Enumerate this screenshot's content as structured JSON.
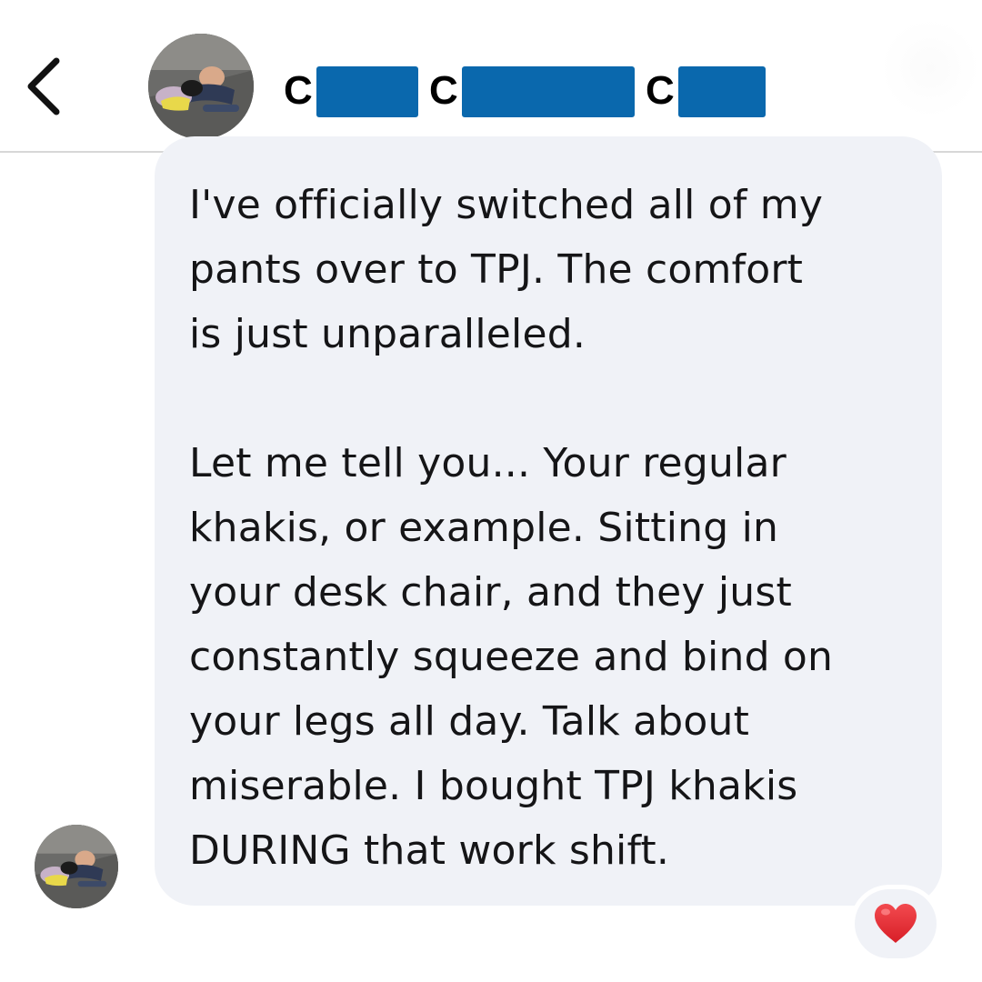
{
  "header": {
    "contact_initials": [
      "C",
      "C",
      "C"
    ],
    "redaction_color": "#0a68ad",
    "back_icon": "chevron-left-icon",
    "avatar": "contact-avatar"
  },
  "message": {
    "paragraphs": [
      [
        "I've officially switched all of my",
        "pants over to TPJ. The comfort",
        "is just unparalleled."
      ],
      [
        "Let me tell you... Your regular",
        "khakis, or example. Sitting in",
        "your desk chair, and they just",
        "constantly squeeze and bind on",
        "your legs all day. Talk about",
        "miserable. I bought TPJ khakis",
        "DURING that work shift."
      ]
    ],
    "bubble_color": "#f0f2f7"
  },
  "reaction": {
    "icon": "red-heart-icon",
    "color": "#e8262f"
  }
}
